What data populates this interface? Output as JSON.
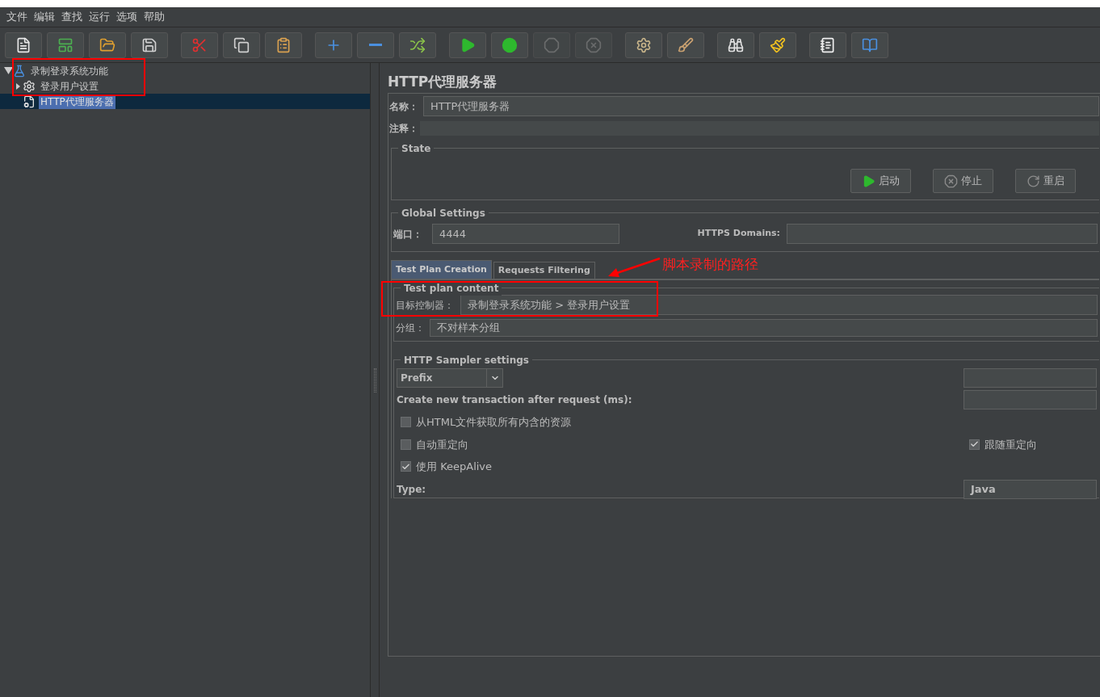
{
  "menu": [
    "文件",
    "编辑",
    "查找",
    "运行",
    "选项",
    "帮助"
  ],
  "toolbar": [
    [
      {
        "kind": "new",
        "disabled": false
      },
      {
        "kind": "templates",
        "disabled": false
      },
      {
        "kind": "open",
        "disabled": false
      },
      {
        "kind": "save",
        "disabled": false
      }
    ],
    [
      {
        "kind": "cut",
        "disabled": false
      },
      {
        "kind": "copy",
        "disabled": false
      },
      {
        "kind": "paste",
        "disabled": false
      }
    ],
    [
      {
        "kind": "expand",
        "disabled": false
      },
      {
        "kind": "collapse",
        "disabled": false
      },
      {
        "kind": "toggle",
        "disabled": false
      }
    ],
    [
      {
        "kind": "start",
        "disabled": false
      },
      {
        "kind": "start_no_pauses",
        "disabled": false
      },
      {
        "kind": "stop",
        "disabled": true
      },
      {
        "kind": "shutdown",
        "disabled": true
      }
    ],
    [
      {
        "kind": "clear",
        "disabled": false
      },
      {
        "kind": "clear_all",
        "disabled": false
      }
    ],
    [
      {
        "kind": "search",
        "disabled": false
      },
      {
        "kind": "reset_search",
        "disabled": false
      }
    ],
    [
      {
        "kind": "functions",
        "disabled": false
      },
      {
        "kind": "help",
        "disabled": false
      }
    ]
  ],
  "tree": [
    {
      "label": "录制登录系统功能",
      "kind": "plan",
      "expanded": true,
      "selected": false,
      "children": [
        {
          "label": "登录用户设置",
          "kind": "config",
          "expanded": false,
          "selected": false
        },
        {
          "label": "HTTP代理服务器",
          "kind": "proxy",
          "selected": true
        }
      ]
    }
  ],
  "panel": {
    "title": "HTTP代理服务器",
    "name_label": "名称：",
    "name_value": "HTTP代理服务器",
    "comment_label": "注释：",
    "state": {
      "legend": "State",
      "buttons": [
        {
          "label": "启动",
          "kind": "start"
        },
        {
          "label": "停止",
          "kind": "stop"
        },
        {
          "label": "重启",
          "kind": "restart"
        }
      ]
    },
    "global": {
      "legend": "Global Settings",
      "port_label": "端口：",
      "port_value": "4444",
      "https_label": "HTTPS Domains:"
    },
    "tabs": [
      {
        "label": "Test Plan Creation",
        "selected": true
      },
      {
        "label": "Requests Filtering",
        "selected": false
      }
    ],
    "content": {
      "legend": "Test plan content",
      "target_label": "目标控制器：",
      "target_value": "录制登录系统功能 > 登录用户设置",
      "group_label": "分组：",
      "group_value": "不对样本分组"
    },
    "sampler": {
      "legend": "HTTP Sampler settings",
      "prefix": "Prefix",
      "transaction_label": "Create new transaction after request (ms):",
      "checkbox_rows": [
        [
          {
            "label": "从HTML文件获取所有内含的资源",
            "checked": false
          }
        ],
        [
          {
            "label": "自动重定向",
            "checked": false
          },
          {
            "label": "跟随重定向",
            "checked": true
          }
        ],
        [
          {
            "label": "使用 KeepAlive",
            "checked": true
          }
        ]
      ],
      "type_label": "Type:",
      "type_value": "Java"
    }
  },
  "annotation": {
    "text": "脚本录制的路径"
  }
}
